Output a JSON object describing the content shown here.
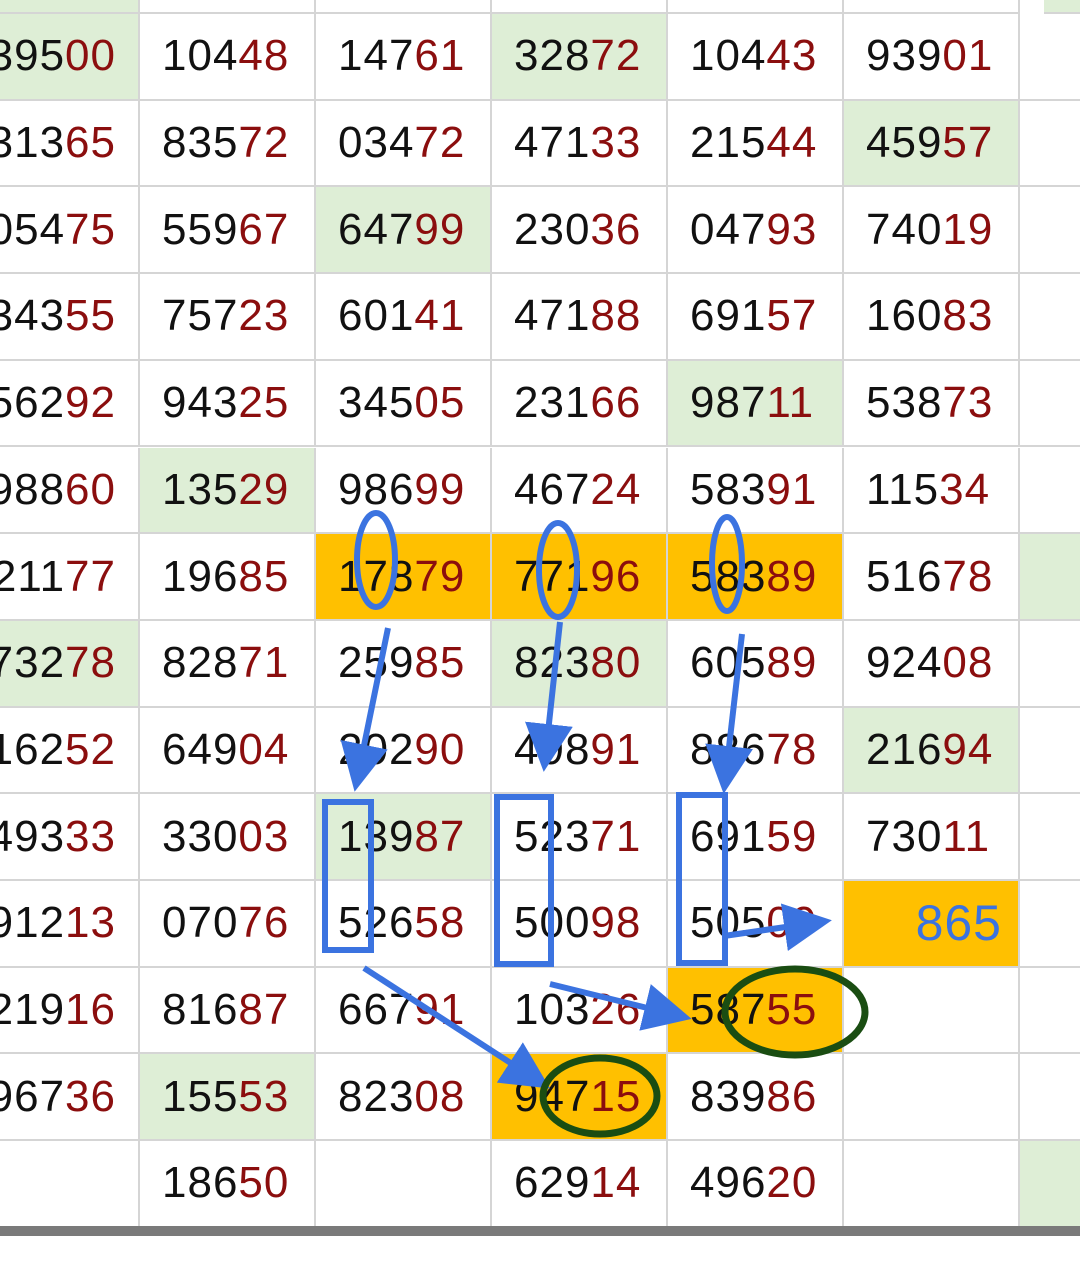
{
  "colors": {
    "digit_dark": "#111111",
    "digit_red": "#8b0e0e",
    "cell_green": "#deeed6",
    "cell_orange": "#ffc000",
    "annotation_blue": "#3b73e0",
    "annotation_dark_green": "#1a4d12",
    "grid_line": "#d5d5d5"
  },
  "grid": {
    "rows": [
      [
        {
          "a": "395",
          "b": "00",
          "fill": "green"
        },
        {
          "a": "104",
          "b": "48"
        },
        {
          "a": "147",
          "b": "61"
        },
        {
          "a": "328",
          "b": "72",
          "fill": "green"
        },
        {
          "a": "104",
          "b": "43"
        },
        {
          "a": "939",
          "b": "01"
        },
        {
          "a": "",
          "b": ""
        }
      ],
      [
        {
          "a": "313",
          "b": "65"
        },
        {
          "a": "835",
          "b": "72"
        },
        {
          "a": "034",
          "b": "72"
        },
        {
          "a": "471",
          "b": "33"
        },
        {
          "a": "215",
          "b": "44"
        },
        {
          "a": "459",
          "b": "57",
          "fill": "green"
        },
        {
          "a": "",
          "b": ""
        }
      ],
      [
        {
          "a": "054",
          "b": "75"
        },
        {
          "a": "559",
          "b": "67"
        },
        {
          "a": "647",
          "b": "99",
          "fill": "green"
        },
        {
          "a": "230",
          "b": "36"
        },
        {
          "a": "047",
          "b": "93"
        },
        {
          "a": "740",
          "b": "19"
        },
        {
          "a": "",
          "b": ""
        }
      ],
      [
        {
          "a": "343",
          "b": "55"
        },
        {
          "a": "757",
          "b": "23"
        },
        {
          "a": "601",
          "b": "41"
        },
        {
          "a": "471",
          "b": "88"
        },
        {
          "a": "691",
          "b": "57"
        },
        {
          "a": "160",
          "b": "83"
        },
        {
          "a": "",
          "b": ""
        }
      ],
      [
        {
          "a": "562",
          "b": "92"
        },
        {
          "a": "943",
          "b": "25"
        },
        {
          "a": "345",
          "b": "05"
        },
        {
          "a": "231",
          "b": "66"
        },
        {
          "a": "987",
          "b": "11",
          "fill": "green"
        },
        {
          "a": "538",
          "b": "73"
        },
        {
          "a": "",
          "b": ""
        }
      ],
      [
        {
          "a": "988",
          "b": "60"
        },
        {
          "a": "135",
          "b": "29",
          "fill": "green"
        },
        {
          "a": "986",
          "b": "99"
        },
        {
          "a": "467",
          "b": "24"
        },
        {
          "a": "583",
          "b": "91"
        },
        {
          "a": "115",
          "b": "34"
        },
        {
          "a": "",
          "b": ""
        }
      ],
      [
        {
          "a": "211",
          "b": "77"
        },
        {
          "a": "196",
          "b": "85"
        },
        {
          "a": "178",
          "b": "79",
          "fill": "orange"
        },
        {
          "a": "771",
          "b": "96",
          "fill": "orange"
        },
        {
          "a": "583",
          "b": "89",
          "fill": "orange"
        },
        {
          "a": "516",
          "b": "78"
        },
        {
          "a": "",
          "b": "",
          "fill": "green"
        }
      ],
      [
        {
          "a": "732",
          "b": "78",
          "fill": "green"
        },
        {
          "a": "828",
          "b": "71"
        },
        {
          "a": "259",
          "b": "85"
        },
        {
          "a": "823",
          "b": "80",
          "fill": "green"
        },
        {
          "a": "605",
          "b": "89"
        },
        {
          "a": "924",
          "b": "08"
        },
        {
          "a": "",
          "b": ""
        }
      ],
      [
        {
          "a": "162",
          "b": "52"
        },
        {
          "a": "649",
          "b": "04"
        },
        {
          "a": "202",
          "b": "90"
        },
        {
          "a": "498",
          "b": "91"
        },
        {
          "a": "886",
          "b": "78"
        },
        {
          "a": "216",
          "b": "94",
          "fill": "green"
        },
        {
          "a": "",
          "b": ""
        }
      ],
      [
        {
          "a": "493",
          "b": "33"
        },
        {
          "a": "330",
          "b": "03"
        },
        {
          "a": "139",
          "b": "87",
          "fill": "green"
        },
        {
          "a": "523",
          "b": "71"
        },
        {
          "a": "691",
          "b": "59"
        },
        {
          "a": "730",
          "b": "11"
        },
        {
          "a": "",
          "b": ""
        }
      ],
      [
        {
          "a": "912",
          "b": "13"
        },
        {
          "a": "070",
          "b": "76"
        },
        {
          "a": "526",
          "b": "58"
        },
        {
          "a": "500",
          "b": "98"
        },
        {
          "a": "505",
          "b": "09"
        },
        {
          "a": "865",
          "b": "",
          "fill": "orange",
          "result": true
        },
        {
          "a": "",
          "b": ""
        }
      ],
      [
        {
          "a": "219",
          "b": "16"
        },
        {
          "a": "816",
          "b": "87"
        },
        {
          "a": "667",
          "b": "91"
        },
        {
          "a": "103",
          "b": "26"
        },
        {
          "a": "587",
          "b": "55",
          "fill": "orange"
        },
        {
          "a": "",
          "b": ""
        },
        {
          "a": "",
          "b": ""
        }
      ],
      [
        {
          "a": "967",
          "b": "36"
        },
        {
          "a": "155",
          "b": "53",
          "fill": "green"
        },
        {
          "a": "823",
          "b": "08"
        },
        {
          "a": "947",
          "b": "15",
          "fill": "orange"
        },
        {
          "a": "839",
          "b": "86"
        },
        {
          "a": "",
          "b": ""
        },
        {
          "a": "",
          "b": ""
        }
      ],
      [
        {
          "a": "",
          "b": ""
        },
        {
          "a": "186",
          "b": "50"
        },
        {
          "a": "",
          "b": ""
        },
        {
          "a": "629",
          "b": "14"
        },
        {
          "a": "496",
          "b": "20"
        },
        {
          "a": "",
          "b": ""
        },
        {
          "a": "",
          "b": "",
          "fill": "green"
        }
      ]
    ]
  }
}
